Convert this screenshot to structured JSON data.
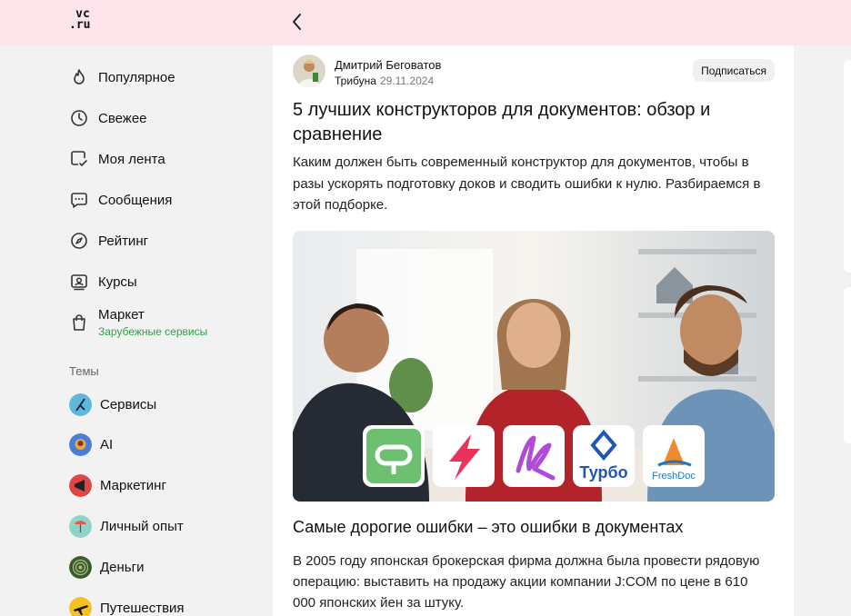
{
  "header": {
    "logo_line1": "vc",
    "logo_line2": ".ru"
  },
  "sidebar": {
    "items": [
      {
        "label": "Популярное",
        "icon": "flame-icon"
      },
      {
        "label": "Свежее",
        "icon": "clock-icon"
      },
      {
        "label": "Моя лента",
        "icon": "feed-check-icon"
      },
      {
        "label": "Сообщения",
        "icon": "message-icon"
      },
      {
        "label": "Рейтинг",
        "icon": "compass-icon"
      },
      {
        "label": "Курсы",
        "icon": "courses-icon"
      },
      {
        "label": "Маркет",
        "sublabel": "Зарубежные сервисы",
        "icon": "bag-icon"
      }
    ],
    "themes_title": "Темы",
    "themes": [
      {
        "label": "Сервисы"
      },
      {
        "label": "AI"
      },
      {
        "label": "Маркетинг"
      },
      {
        "label": "Личный опыт"
      },
      {
        "label": "Деньги"
      },
      {
        "label": "Путешествия"
      }
    ]
  },
  "post": {
    "author": "Дмитрий Беговатов",
    "channel": "Трибуна",
    "date": "29.11.2024",
    "subscribe_label": "Подписаться",
    "title": "5 лучших конструкторов для документов: обзор и сравнение",
    "lead": "Каким должен быть современный конструктор для документов, чтобы в разы ускорять подготовку доков и сводить ошибки к нулю. Разбираемся в этой подборке.",
    "cover_logos": [
      "Турбо",
      "FreshDoc"
    ],
    "subheading": "Самые дорогие ошибки – это ошибки в документах",
    "paragraph": "В 2005 году японская брокерская фирма должна была провести рядовую операцию: выставить на продажу акции компании J:COM по цене в 610 000 японских йен за штуку."
  },
  "colors": {
    "header_bg": "#fce4ea",
    "accent_green": "#2ca24b",
    "page_bg": "#f2f2f2"
  }
}
